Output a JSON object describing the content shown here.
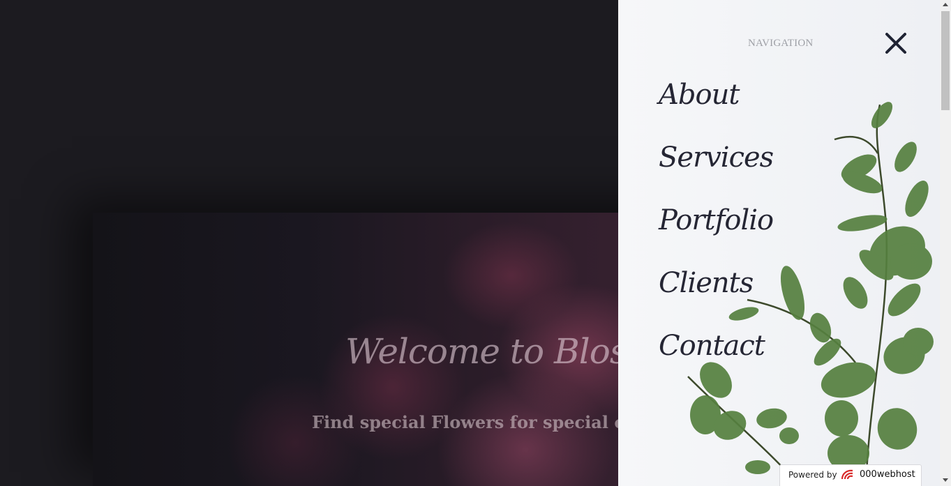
{
  "hero": {
    "title": "Welcome to Blossoms",
    "subtitle": "Find special Flowers for special occasions"
  },
  "nav": {
    "heading": "NAVIGATION",
    "items": [
      {
        "label": "About"
      },
      {
        "label": "Services"
      },
      {
        "label": "Portfolio"
      },
      {
        "label": "Clients"
      },
      {
        "label": "Contact"
      }
    ],
    "close_icon": "close-icon"
  },
  "badge": {
    "powered_label": "Powered by",
    "brand": "000webhost"
  },
  "colors": {
    "background": "#1c1b20",
    "nav_background": "#f4f5f8",
    "nav_text": "#252634",
    "leaf_green": "#4f7a3c"
  }
}
